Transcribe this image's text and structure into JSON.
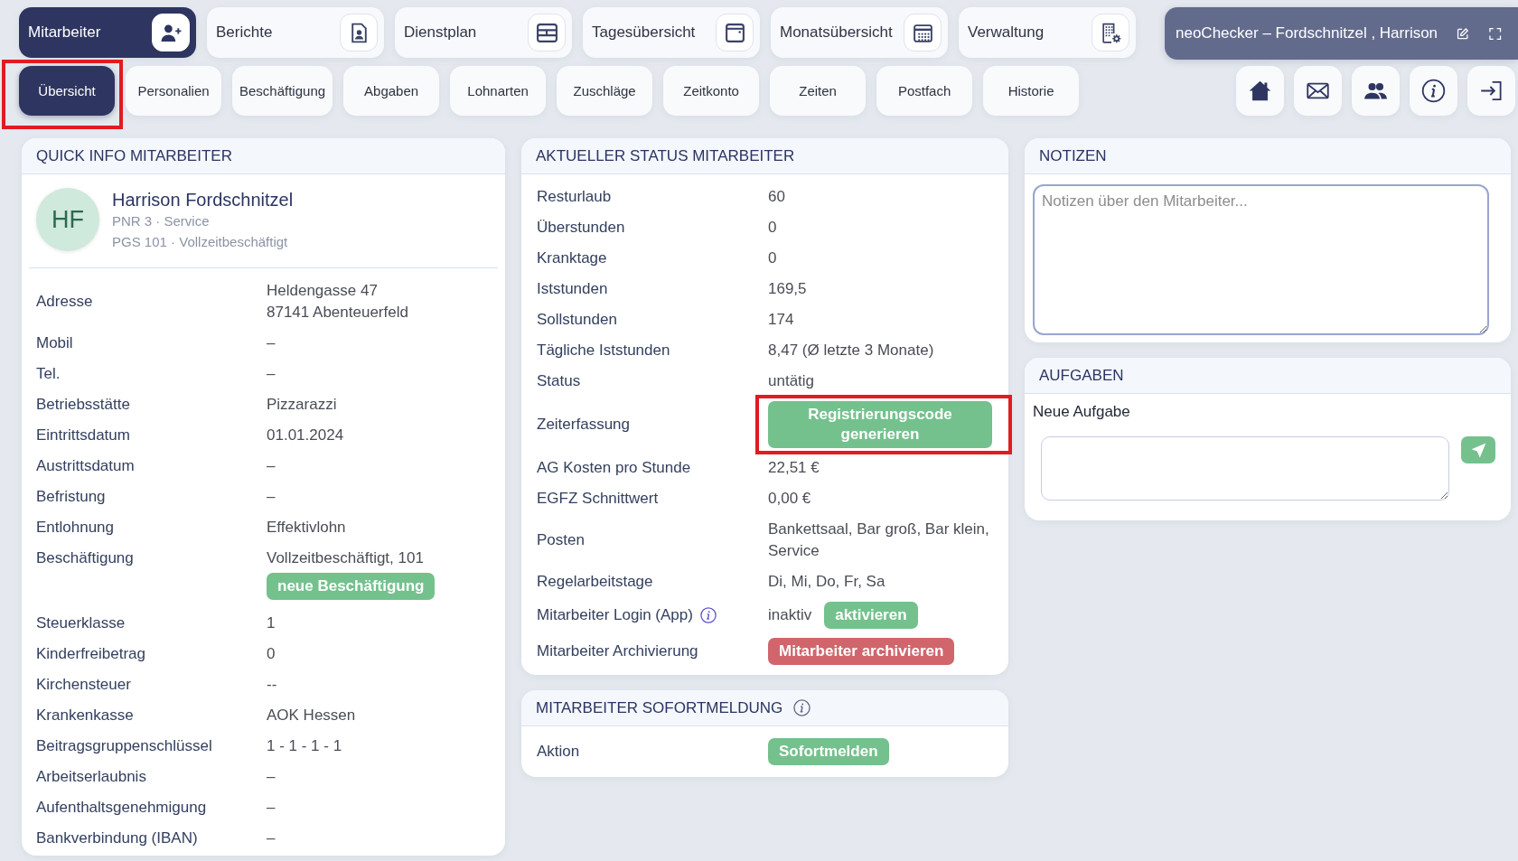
{
  "main_nav": [
    {
      "label": "Mitarbeiter",
      "selected": true
    },
    {
      "label": "Berichte",
      "selected": false
    },
    {
      "label": "Dienstplan",
      "selected": false
    },
    {
      "label": "Tagesübersicht",
      "selected": false
    },
    {
      "label": "Monatsübersicht",
      "selected": false
    },
    {
      "label": "Verwaltung",
      "selected": false
    }
  ],
  "title_bar": {
    "title": "neoChecker – Fordschnitzel , Harrison"
  },
  "tabs": [
    {
      "label": "Übersicht",
      "selected": true,
      "highlighted": true
    },
    {
      "label": "Personalien",
      "selected": false,
      "highlighted": false
    },
    {
      "label": "Beschäftigung",
      "selected": false,
      "highlighted": false
    },
    {
      "label": "Abgaben",
      "selected": false,
      "highlighted": false
    },
    {
      "label": "Lohnarten",
      "selected": false,
      "highlighted": false
    },
    {
      "label": "Zuschläge",
      "selected": false,
      "highlighted": false
    },
    {
      "label": "Zeitkonto",
      "selected": false,
      "highlighted": false
    },
    {
      "label": "Zeiten",
      "selected": false,
      "highlighted": false
    },
    {
      "label": "Postfach",
      "selected": false,
      "highlighted": false
    },
    {
      "label": "Historie",
      "selected": false,
      "highlighted": false
    }
  ],
  "quick_info": {
    "title": "QUICK INFO MITARBEITER",
    "avatar_initials": "HF",
    "name": "Harrison Fordschnitzel",
    "details": [
      "PNR 3 · Service",
      "PGS 101 · Vollzeitbeschäftigt"
    ],
    "rows": [
      {
        "label": "Adresse",
        "value_lines": [
          "Heldengasse 47",
          "87141 Abenteuerfeld"
        ]
      },
      {
        "label": "Mobil",
        "value": "–"
      },
      {
        "label": "Tel.",
        "value": "–"
      },
      {
        "label": "Betriebsstätte",
        "value": "Pizzarazzi"
      },
      {
        "label": "Eintrittsdatum",
        "value": "01.01.2024"
      },
      {
        "label": "Austrittsdatum",
        "value": "–"
      },
      {
        "label": "Befristung",
        "value": "–"
      },
      {
        "label": "Entlohnung",
        "value": "Effektivlohn"
      },
      {
        "label": "Beschäftigung",
        "value": "Vollzeitbeschäftigt, 101",
        "button": {
          "label": "neue Beschäftigung",
          "kind": "success"
        }
      },
      {
        "label": "Steuerklasse",
        "value": "1"
      },
      {
        "label": "Kinderfreibetrag",
        "value": "0"
      },
      {
        "label": "Kirchensteuer",
        "value": "--"
      },
      {
        "label": "Krankenkasse",
        "value": "AOK Hessen"
      },
      {
        "label": "Beitragsgruppenschlüssel",
        "value": "1 - 1 - 1 - 1"
      },
      {
        "label": "Arbeitserlaubnis",
        "value": "–"
      },
      {
        "label": "Aufenthaltsgenehmigung",
        "value": "–"
      },
      {
        "label": "Bankverbindung (IBAN)",
        "value": "–"
      }
    ]
  },
  "status": {
    "title": "AKTUELLER STATUS MITARBEITER",
    "rows": [
      {
        "label": "Resturlaub",
        "value": "60",
        "info": false,
        "highlighted": false
      },
      {
        "label": "Überstunden",
        "value": "0",
        "info": false,
        "highlighted": false
      },
      {
        "label": "Kranktage",
        "value": "0",
        "info": false,
        "highlighted": false
      },
      {
        "label": "Iststunden",
        "value": "169,5",
        "info": false,
        "highlighted": false
      },
      {
        "label": "Sollstunden",
        "value": "174",
        "info": false,
        "highlighted": false
      },
      {
        "label": "Tägliche Iststunden",
        "value": "8,47 (Ø letzte 3 Monate)",
        "info": false,
        "highlighted": false
      },
      {
        "label": "Status",
        "value": "untätig",
        "info": false,
        "highlighted": false
      },
      {
        "label": "Zeiterfassung",
        "button": {
          "label": "Registrierungscode generieren",
          "kind": "success"
        },
        "info": false,
        "highlighted": true
      },
      {
        "label": "AG Kosten pro Stunde",
        "value": "22,51 €",
        "info": false,
        "highlighted": false
      },
      {
        "label": "EGFZ Schnittwert",
        "value": "0,00 €",
        "info": false,
        "highlighted": false
      },
      {
        "label": "Posten",
        "value": "Bankettsaal, Bar groß, Bar klein, Service",
        "info": false,
        "highlighted": false
      },
      {
        "label": "Regelarbeitstage",
        "value": "Di, Mi, Do, Fr, Sa",
        "info": false,
        "highlighted": false
      },
      {
        "label": "Mitarbeiter Login (App)",
        "value": "inaktiv",
        "button": {
          "label": "aktivieren",
          "kind": "success"
        },
        "info": true,
        "highlighted": false
      },
      {
        "label": "Mitarbeiter Archivierung",
        "button": {
          "label": "Mitarbeiter archivieren",
          "kind": "danger"
        },
        "info": false,
        "highlighted": false
      }
    ]
  },
  "instant_report": {
    "title": "MITARBEITER SOFORTMELDUNG",
    "info": true,
    "rows": [
      {
        "label": "Aktion",
        "button": {
          "label": "Sofortmelden",
          "kind": "success"
        }
      }
    ]
  },
  "notes": {
    "title": "NOTIZEN",
    "placeholder": "Notizen über den Mitarbeiter..."
  },
  "tasks": {
    "title": "AUFGABEN",
    "label": "Neue Aufgabe"
  }
}
